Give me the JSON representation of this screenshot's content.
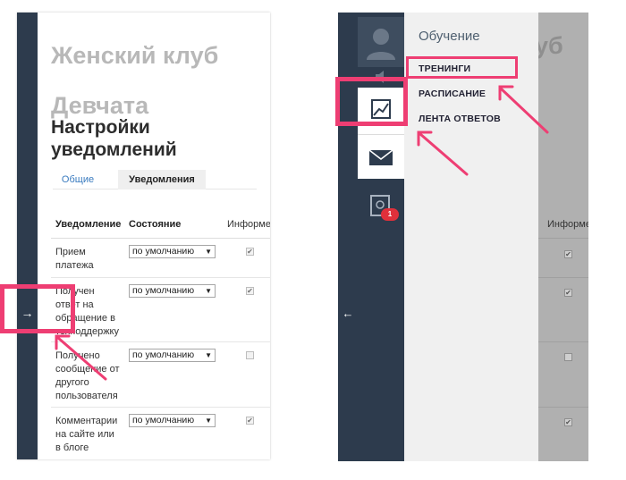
{
  "left_panel": {
    "expand_arrow": "→",
    "site_title": "Женский клуб Девчата",
    "page_title": "Настройки уведомлений",
    "tabs": [
      {
        "label": "Общие",
        "active": false
      },
      {
        "label": "Уведомления",
        "active": true
      }
    ],
    "table": {
      "headers": [
        "Уведомление",
        "Состояние",
        "Информе"
      ],
      "rows": [
        {
          "label": "Прием платежа",
          "state": "по умолчанию",
          "checked": true
        },
        {
          "label": "Получен ответ на обращение в техподдержку",
          "state": "по умолчанию",
          "checked": true
        },
        {
          "label": "Получено сообщение от другого пользователя",
          "state": "по умолчанию",
          "checked": false
        },
        {
          "label": "Комментарии на сайте или в блоге",
          "state": "по умолчанию",
          "checked": true
        }
      ]
    }
  },
  "right_panel": {
    "menu_title": "Обучение",
    "menu_items": [
      "ТРЕНИНГИ",
      "РАСПИСАНИЕ",
      "ЛЕНТА ОТВЕТОВ"
    ],
    "collapse_arrow": "←",
    "badge_count": "1",
    "background_title_fragment": "уб",
    "background_column_header": "Информе",
    "icons": [
      "avatar-icon",
      "speaker-icon",
      "chart-icon",
      "mail-icon",
      "certificate-icon"
    ]
  },
  "highlight_color": "#ee3e73",
  "sidebar_color": "#2d3b4d",
  "link_color": "#3a7bbf"
}
